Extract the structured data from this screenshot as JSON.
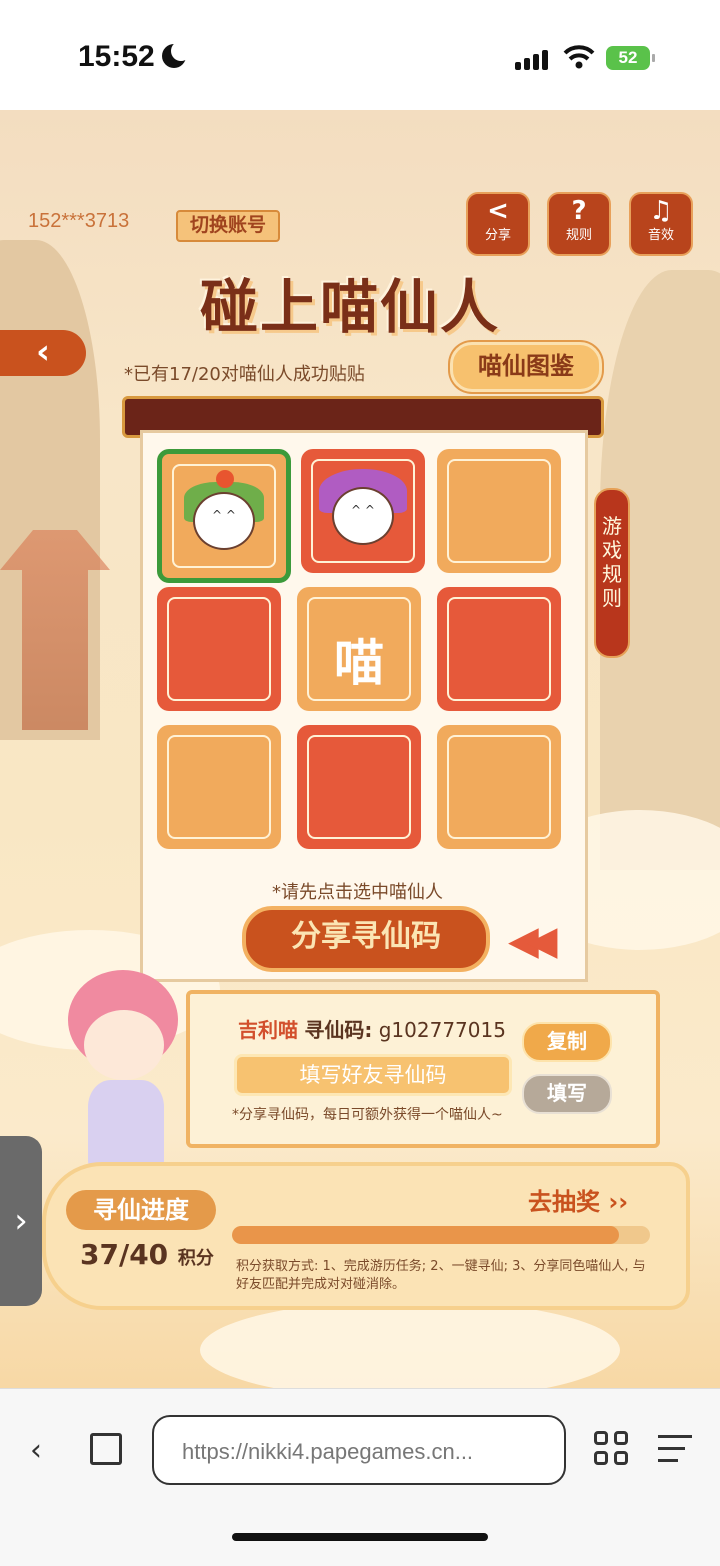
{
  "status_bar": {
    "time": "15:52",
    "battery": "52"
  },
  "game": {
    "account": "152***3713",
    "switch_account": "切换账号",
    "top_buttons": {
      "share": "分享",
      "rules": "规则",
      "sound": "音效"
    },
    "title": "碰上喵仙人",
    "progress_note": "*已有17/20对喵仙人成功贴贴",
    "dex_button": "喵仙图鉴",
    "side_rules": "游戏规则",
    "center_card_text": "喵",
    "select_tip": "*请先点击选中喵仙人",
    "share_code_button": "分享寻仙码",
    "code_panel": {
      "name": "吉利喵",
      "code_label": "寻仙码:",
      "code_value": "g102777015",
      "copy_button": "复制",
      "fill_placeholder": "填写好友寻仙码",
      "fill_button": "填写",
      "note": "*分享寻仙码，每日可额外获得一个喵仙人~"
    },
    "progress": {
      "badge": "寻仙进度",
      "current": "37",
      "total": "40",
      "unit": "积分",
      "fraction": 0.925,
      "draw_link": "去抽奖 ››",
      "note": "积分获取方式: 1、完成游历任务; 2、一键寻仙; 3、分享同色喵仙人, 与好友匹配并完成对对碰消除。"
    }
  },
  "browser": {
    "url": "https://nikki4.papegames.cn..."
  },
  "colors": {
    "accent": "#c9521e",
    "card_orange": "#f1aa5c",
    "card_red": "#e6593a",
    "selected": "#3c9a3a"
  }
}
